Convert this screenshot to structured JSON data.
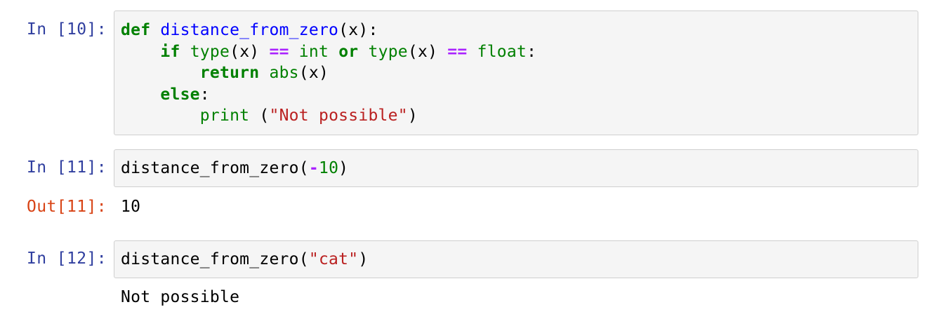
{
  "cells": [
    {
      "prompt": "In [10]:",
      "lines": [
        {
          "indent": "",
          "tokens": [
            {
              "t": "kw",
              "v": "def"
            },
            {
              "t": "plain",
              "v": " "
            },
            {
              "t": "fn",
              "v": "distance_from_zero"
            },
            {
              "t": "plain",
              "v": "(x):"
            }
          ]
        },
        {
          "indent": "    ",
          "tokens": [
            {
              "t": "kw",
              "v": "if"
            },
            {
              "t": "plain",
              "v": " "
            },
            {
              "t": "bi",
              "v": "type"
            },
            {
              "t": "plain",
              "v": "(x) "
            },
            {
              "t": "op",
              "v": "=="
            },
            {
              "t": "plain",
              "v": " "
            },
            {
              "t": "bi",
              "v": "int"
            },
            {
              "t": "plain",
              "v": " "
            },
            {
              "t": "kw",
              "v": "or"
            },
            {
              "t": "plain",
              "v": " "
            },
            {
              "t": "bi",
              "v": "type"
            },
            {
              "t": "plain",
              "v": "(x) "
            },
            {
              "t": "op",
              "v": "=="
            },
            {
              "t": "plain",
              "v": " "
            },
            {
              "t": "bi",
              "v": "float"
            },
            {
              "t": "plain",
              "v": ":"
            }
          ]
        },
        {
          "indent": "        ",
          "tokens": [
            {
              "t": "kw",
              "v": "return"
            },
            {
              "t": "plain",
              "v": " "
            },
            {
              "t": "bi",
              "v": "abs"
            },
            {
              "t": "plain",
              "v": "(x)"
            }
          ]
        },
        {
          "indent": "    ",
          "tokens": [
            {
              "t": "kw",
              "v": "else"
            },
            {
              "t": "plain",
              "v": ":"
            }
          ]
        },
        {
          "indent": "        ",
          "tokens": [
            {
              "t": "bi",
              "v": "print"
            },
            {
              "t": "plain",
              "v": " ("
            },
            {
              "t": "str",
              "v": "\"Not possible\""
            },
            {
              "t": "plain",
              "v": ")"
            }
          ]
        }
      ]
    },
    {
      "prompt": "In [11]:",
      "lines": [
        {
          "indent": "",
          "tokens": [
            {
              "t": "plain",
              "v": "distance_from_zero("
            },
            {
              "t": "op",
              "v": "-"
            },
            {
              "t": "num",
              "v": "10"
            },
            {
              "t": "plain",
              "v": ")"
            }
          ]
        }
      ],
      "out_prompt": "Out[11]:",
      "out_text": "10"
    },
    {
      "prompt": "In [12]:",
      "lines": [
        {
          "indent": "",
          "tokens": [
            {
              "t": "plain",
              "v": "distance_from_zero("
            },
            {
              "t": "str",
              "v": "\"cat\""
            },
            {
              "t": "plain",
              "v": ")"
            }
          ]
        }
      ],
      "stream_text": "Not possible"
    }
  ]
}
